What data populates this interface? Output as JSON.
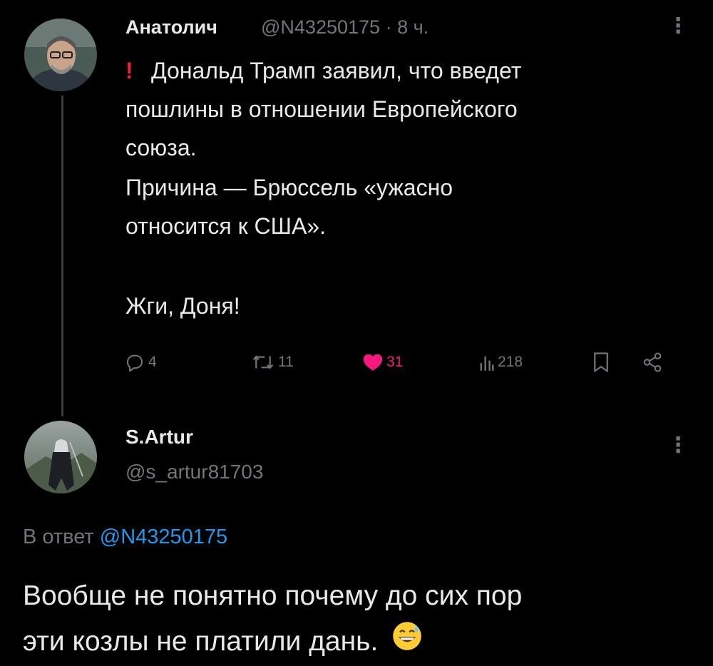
{
  "tweet": {
    "author_name": "Анатолич",
    "author_handle": "@N43250175",
    "time": "8 ч.",
    "separator": "·",
    "alert_mark": "!",
    "text_lines": [
      "Дональд Трамп заявил, что введет",
      "пошлины в отношении Европейского",
      "союза.",
      "Причина — Брюссель «ужасно",
      "относится к США».",
      "Жги, Доня!"
    ],
    "actions": {
      "replies": "4",
      "reposts": "11",
      "likes": "31",
      "views": "218"
    },
    "colors": {
      "like_active": "#f91880",
      "mention": "#1d9bf0",
      "muted": "#71767b"
    }
  },
  "reply": {
    "author_name": "S.Artur",
    "author_handle": "@s_artur81703",
    "reply_to_label": "В ответ",
    "reply_to_handle": "@N43250175",
    "text_lines": [
      "Вообще не понятно почему до сих пор",
      "эти козлы не платили дань."
    ],
    "emoji": "grinning-sweat-emoji"
  },
  "icons": {
    "more": "more-vertical-icon",
    "reply": "reply-icon",
    "repost": "repost-icon",
    "like": "heart-icon",
    "views": "views-icon",
    "bookmark": "bookmark-icon",
    "share": "share-icon"
  }
}
